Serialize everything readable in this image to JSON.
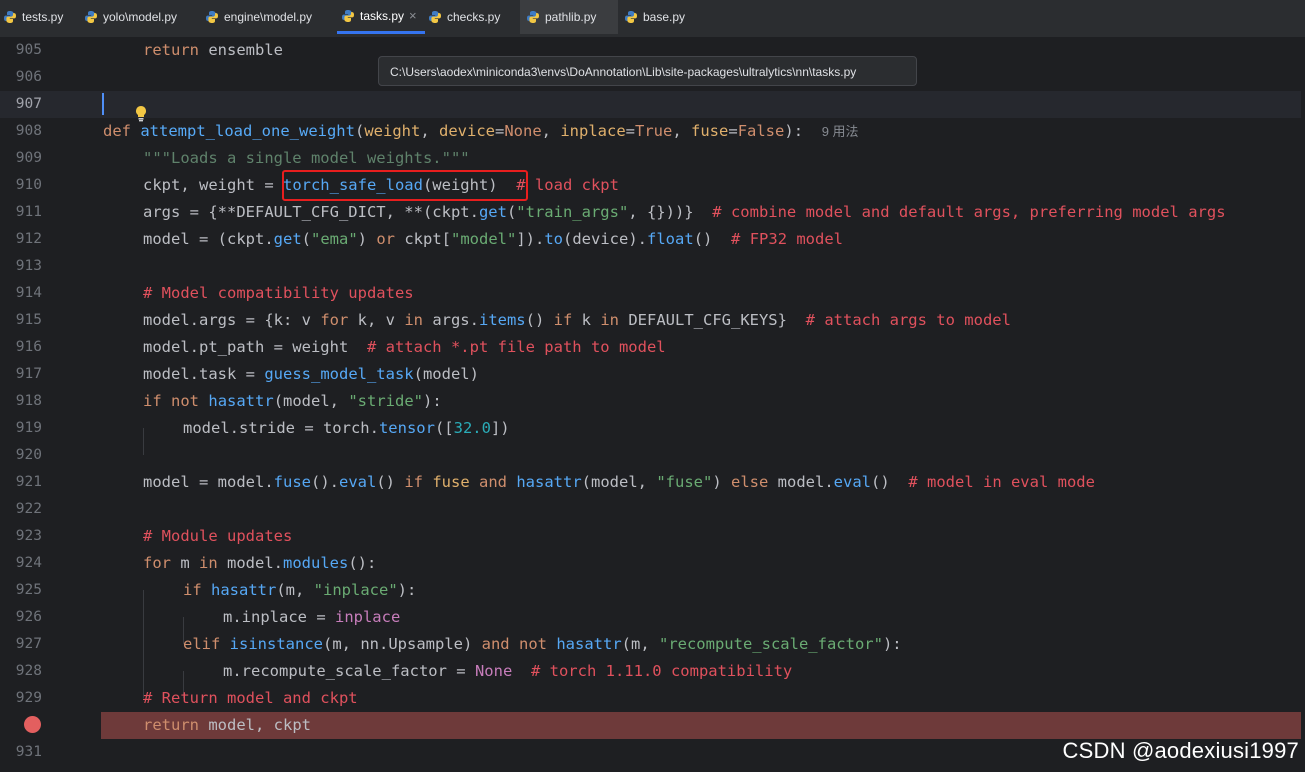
{
  "tabs": [
    {
      "label": "tests.py",
      "active": false
    },
    {
      "label": "yolo\\model.py",
      "active": false
    },
    {
      "label": "engine\\model.py",
      "active": false
    },
    {
      "label": "tasks.py",
      "active": true
    },
    {
      "label": "checks.py",
      "active": false
    },
    {
      "label": "pathlib.py",
      "active": false
    },
    {
      "label": "base.py",
      "active": false
    }
  ],
  "tab_close_glyph": "×",
  "tooltip": {
    "path": "C:\\Users\\aodex\\miniconda3\\envs\\DoAnnotation\\Lib\\site-packages\\ultralytics\\nn\\tasks.py"
  },
  "inlay_hint": "9 用法",
  "line_numbers": [
    "905",
    "906",
    "907",
    "908",
    "909",
    "910",
    "911",
    "912",
    "913",
    "914",
    "915",
    "916",
    "917",
    "918",
    "919",
    "920",
    "921",
    "922",
    "923",
    "924",
    "925",
    "926",
    "927",
    "928",
    "929",
    "",
    "931"
  ],
  "watermark": "CSDN @aodexiusi1997",
  "colors": {
    "keyword": "#cf8e6d",
    "function": "#56a8f5",
    "string": "#6aab73",
    "comment": "#e0515d",
    "highlight_box": "#e81e1e",
    "breakpoint": "#e35f5f",
    "breakpoint_line": "#6e3a3a"
  },
  "icons": {
    "python_file": "python-icon",
    "intention": "lightbulb-icon",
    "breakpoint": "breakpoint-icon"
  },
  "code": {
    "l905": {
      "kw": "return",
      "rest": " ensemble"
    },
    "l908": {
      "def": "def",
      "name": "attempt_load_one_weight",
      "p1": "weight",
      "p2": "device",
      "p2v": "None",
      "p3": "inplace",
      "p3v": "True",
      "p4": "fuse",
      "p4v": "False"
    },
    "l909": "\"\"\"Loads a single model weights.\"\"\"",
    "l910": {
      "pre": "ckpt, weight = ",
      "call": "torch_safe_load",
      "args": "(weight)",
      "comment": "# load ckpt"
    },
    "l911": {
      "pre": "args = {**DEFAULT_CFG_DICT, **(ckpt.",
      "call": "get",
      "s": "\"train_args\"",
      "post": ", {}))}",
      "comment": "# combine model and default args, preferring model args"
    },
    "l912": {
      "pre": "model = (ckpt.",
      "call": "get",
      "s1": "\"ema\"",
      "or": "or",
      "mid": " ckpt[",
      "s2": "\"model\"",
      "post": "]).",
      "call2": "to",
      "a2": "(device).",
      "call3": "float",
      "end": "()",
      "comment": "# FP32 model"
    },
    "l914": "# Model compatibility updates",
    "l915": {
      "pre": "model.args = {k: v ",
      "for": "for",
      "k": " k, v ",
      "in": "in",
      "mid": " args.",
      "call": "items",
      "paren": "() ",
      "if": "if",
      "k2": " k ",
      "in2": "in",
      "post": " DEFAULT_CFG_KEYS}",
      "comment": "# attach args to model"
    },
    "l916": {
      "pre": "model.pt_path = weight",
      "comment": "# attach *.pt file path to model"
    },
    "l917": {
      "pre": "model.task = ",
      "call": "guess_model_task",
      "post": "(model)"
    },
    "l918": {
      "if": "if",
      "not": "not",
      "call": "hasattr",
      "mid": "(model, ",
      "s": "\"stride\"",
      "post": "):"
    },
    "l919": {
      "pre": "model.stride = torch.",
      "call": "tensor",
      "open": "([",
      "num": "32.0",
      "close": "])"
    },
    "l921": {
      "pre": "model = model.",
      "c1": "fuse",
      "p1": "().",
      "c2": "eval",
      "p2": "() ",
      "if": "if",
      "fuse": "fuse",
      "and": "and",
      "c3": "hasattr",
      "mid": "(model, ",
      "s": "\"fuse\"",
      "close": ") ",
      "else": "else",
      "post": " model.",
      "c4": "eval",
      "end": "()",
      "comment": "# model in eval mode"
    },
    "l923": "# Module updates",
    "l924": {
      "for": "for",
      "m": " m ",
      "in": "in",
      "pre": " model.",
      "call": "modules",
      "post": "():"
    },
    "l925": {
      "if": "if",
      "call": "hasattr",
      "mid": "(m, ",
      "s": "\"inplace\"",
      "post": "):"
    },
    "l926": {
      "pre": "m.inplace = ",
      "val": "inplace"
    },
    "l927": {
      "elif": "elif",
      "call": "isinstance",
      "mid": "(m, nn.Upsample) ",
      "and": "and",
      "not": "not",
      "call2": "hasattr",
      "mid2": "(m, ",
      "s": "\"recompute_scale_factor\"",
      "post": "):"
    },
    "l928": {
      "pre": "m.recompute_scale_factor = ",
      "val": "None",
      "comment": "# torch 1.11.0 compatibility"
    },
    "l929": "# Return model and ckpt",
    "l930": {
      "kw": "return",
      "rest": " model, ckpt"
    }
  }
}
